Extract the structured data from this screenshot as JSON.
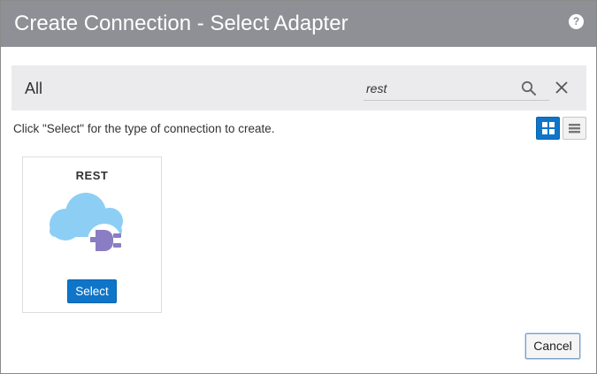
{
  "dialog": {
    "title": "Create Connection - Select Adapter",
    "help_icon_glyph": "?"
  },
  "filter": {
    "category_label": "All",
    "search_value": "rest",
    "search_placeholder": ""
  },
  "instruction": "Click \"Select\" for the type of connection to create.",
  "view_toggle": {
    "active": "grid",
    "accent_color": "#0f75c9"
  },
  "adapters": [
    {
      "name": "REST",
      "icon": "cloud-plug-icon",
      "select_label": "Select"
    }
  ],
  "footer": {
    "cancel_label": "Cancel"
  }
}
